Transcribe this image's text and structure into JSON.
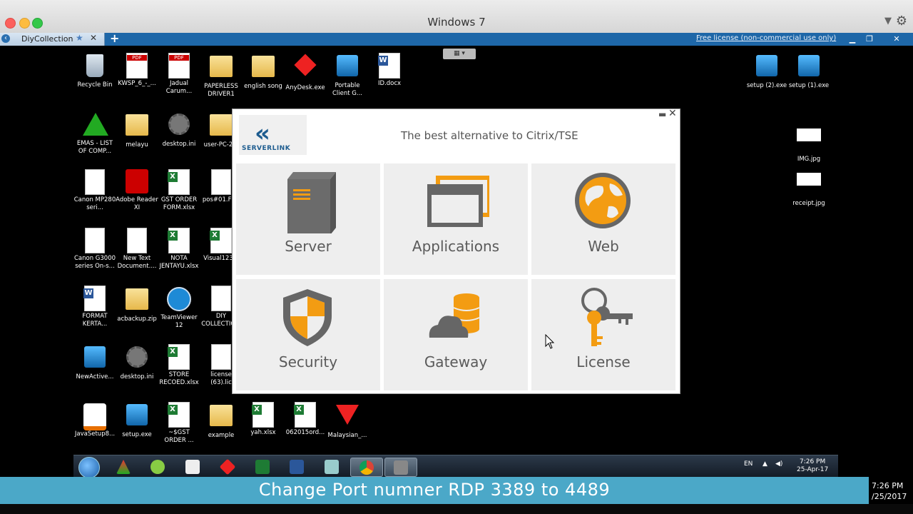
{
  "mac": {
    "title": "Windows 7"
  },
  "vm_tabs": {
    "tab_label": "DiyCollection",
    "license_notice": "Free license (non-commercial use only)"
  },
  "desktop_icons": [
    {
      "label": "Recycle Bin",
      "kind": "bin"
    },
    {
      "label": "KWSP_6_-_...",
      "kind": "pdf"
    },
    {
      "label": "Jadual Carum...",
      "kind": "pdf"
    },
    {
      "label": "PAPERLESS DRIVER1",
      "kind": "folder"
    },
    {
      "label": "english song",
      "kind": "folder"
    },
    {
      "label": "AnyDesk.exe",
      "kind": "anydesk"
    },
    {
      "label": "Portable Client G...",
      "kind": "app"
    },
    {
      "label": "ID.docx",
      "kind": "word"
    },
    {
      "label": "EMAS - LIST OF COMP...",
      "kind": "emas"
    },
    {
      "label": "melayu",
      "kind": "folder"
    },
    {
      "label": "desktop.ini",
      "kind": "gear"
    },
    {
      "label": "user-PC-2...",
      "kind": "folder"
    },
    {
      "label": "Canon MP280 seri...",
      "kind": "doc"
    },
    {
      "label": "Adobe Reader XI",
      "kind": "adobe"
    },
    {
      "label": "GST ORDER FORM.xlsx",
      "kind": "xls"
    },
    {
      "label": "pos#01.FF...",
      "kind": "doc"
    },
    {
      "label": "Canon G3000 series On-s...",
      "kind": "doc"
    },
    {
      "label": "New Text Document....",
      "kind": "doc"
    },
    {
      "label": "NOTA JENTAYU.xlsx",
      "kind": "xls"
    },
    {
      "label": "Visual123...",
      "kind": "xls"
    },
    {
      "label": "FORMAT KERTA...",
      "kind": "word"
    },
    {
      "label": "acbackup.zip",
      "kind": "folder"
    },
    {
      "label": "TeamViewer 12",
      "kind": "teamviewer"
    },
    {
      "label": "DIY COLLECTIO...",
      "kind": "doc"
    },
    {
      "label": "NewActive...",
      "kind": "app"
    },
    {
      "label": "desktop.ini",
      "kind": "gear"
    },
    {
      "label": "STORE RECOED.xlsx",
      "kind": "xls"
    },
    {
      "label": "license (63).lic",
      "kind": "doc"
    },
    {
      "label": "JavaSetup8...",
      "kind": "java"
    },
    {
      "label": "setup.exe",
      "kind": "app"
    },
    {
      "label": "~$GST ORDER ...",
      "kind": "xls"
    },
    {
      "label": "example",
      "kind": "folder"
    },
    {
      "label": "yah.xlsx",
      "kind": "xls"
    },
    {
      "label": "062015ord...",
      "kind": "xls"
    },
    {
      "label": "Malaysian_...",
      "kind": "malaysian"
    },
    {
      "label": "setup (2).exe",
      "kind": "app"
    },
    {
      "label": "setup (1).exe",
      "kind": "app"
    },
    {
      "label": "IMG.jpg",
      "kind": "img"
    },
    {
      "label": "receipt.jpg",
      "kind": "img"
    }
  ],
  "app": {
    "brand": "SERVERLINK",
    "tagline": "The best alternative to Citrix/TSE",
    "tiles": [
      {
        "label": "Server",
        "icon": "server-icon"
      },
      {
        "label": "Applications",
        "icon": "applications-icon"
      },
      {
        "label": "Web",
        "icon": "globe-icon"
      },
      {
        "label": "Security",
        "icon": "shield-icon"
      },
      {
        "label": "Gateway",
        "icon": "cloud-database-icon"
      },
      {
        "label": "License",
        "icon": "keys-icon"
      }
    ]
  },
  "taskbar": {
    "lang": "EN",
    "time": "7:26 PM",
    "date": "25-Apr-17"
  },
  "caption": {
    "text": "Change Port numner RDP 3389 to 4489"
  },
  "right_clock": {
    "time": "7:26 PM",
    "date": "/25/2017"
  },
  "colors": {
    "accent_orange": "#f39c12",
    "tile_bg": "#eeeeee",
    "caption_bg": "#4ba8c8"
  }
}
